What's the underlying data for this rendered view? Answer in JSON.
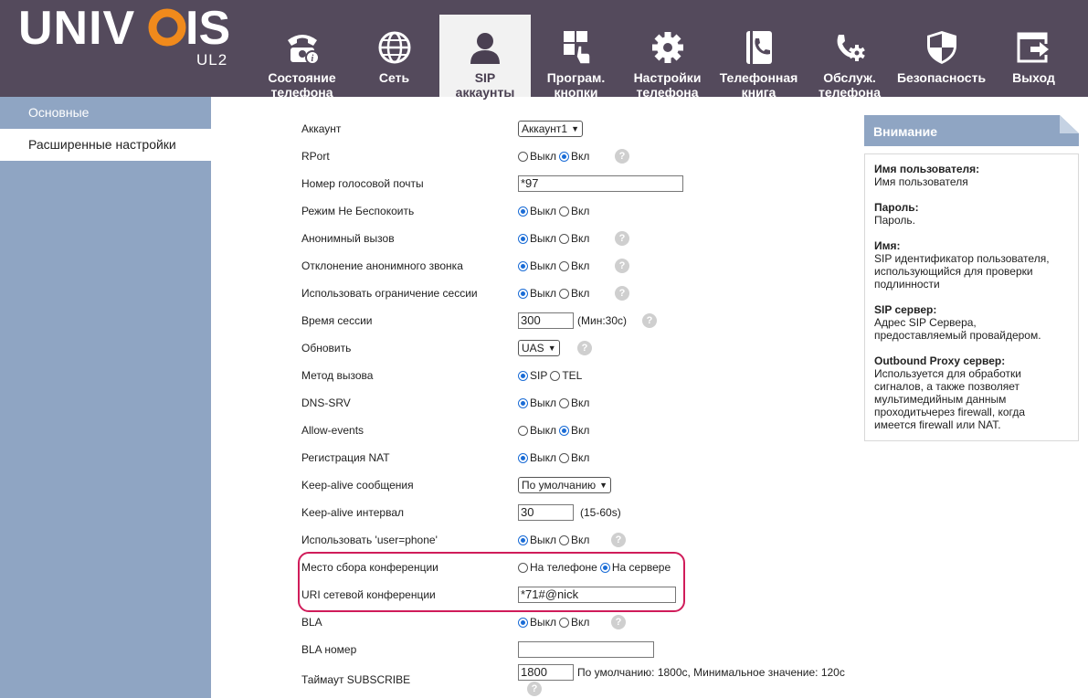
{
  "brand": {
    "logo": "UNIVOIS",
    "model": "UL2"
  },
  "nav": [
    {
      "label": "Состояние телефона",
      "icon": "phone-info-icon"
    },
    {
      "label": "Сеть",
      "icon": "globe-icon"
    },
    {
      "label": "SIP аккаунты",
      "icon": "user-icon",
      "active": true
    },
    {
      "label": "Програм. кнопки",
      "icon": "grid-touch-icon"
    },
    {
      "label": "Настройки телефона",
      "icon": "gear-icon"
    },
    {
      "label": "Телефонная книга",
      "icon": "phonebook-icon"
    },
    {
      "label": "Обслуж. телефона",
      "icon": "phone-wrench-icon"
    },
    {
      "label": "Безопасность",
      "icon": "shield-icon"
    },
    {
      "label": "Выход",
      "icon": "logout-icon"
    }
  ],
  "sidebar": {
    "items": [
      {
        "label": "Основные"
      },
      {
        "label": "Расширенные настройки",
        "active": true
      }
    ]
  },
  "radio_labels": {
    "off": "Выкл",
    "on": "Вкл",
    "sip": "SIP",
    "tel": "TEL",
    "phone": "На телефоне",
    "server": "На сервере"
  },
  "help_glyph": "?",
  "form": {
    "account": {
      "label": "Аккаунт",
      "value": "Аккаунт1"
    },
    "rport": {
      "label": "RPort",
      "value": "on"
    },
    "voicemail": {
      "label": "Номер голосовой почты",
      "value": "*97"
    },
    "dnd": {
      "label": "Режим Не Беспокоить",
      "value": "off"
    },
    "anon_call": {
      "label": "Анонимный вызов",
      "value": "off"
    },
    "anon_reject": {
      "label": "Отклонение анонимного звонка",
      "value": "off"
    },
    "session_limit": {
      "label": "Использовать ограничение сессии",
      "value": "off"
    },
    "session_time": {
      "label": "Время сессии",
      "value": "300",
      "unit": "(Мин:30с)"
    },
    "refresher": {
      "label": "Обновить",
      "value": "UAS"
    },
    "call_method": {
      "label": "Метод вызова",
      "value": "SIP"
    },
    "dns_srv": {
      "label": "DNS-SRV",
      "value": "off"
    },
    "allow_events": {
      "label": "Allow-events",
      "value": "on"
    },
    "nat_reg": {
      "label": "Регистрация NAT",
      "value": "off"
    },
    "keepalive_msg": {
      "label": "Keep-alive сообщения",
      "value": "По умолчанию"
    },
    "keepalive_int": {
      "label": "Keep-alive интервал",
      "value": "30",
      "unit": "(15-60s)"
    },
    "user_phone": {
      "label": "Использовать 'user=phone'",
      "value": "off"
    },
    "conf_place": {
      "label": "Место сбора конференции",
      "value": "server"
    },
    "conf_uri": {
      "label": "URI сетевой конференции",
      "value": "*71#@nick"
    },
    "bla": {
      "label": "BLA",
      "value": "off"
    },
    "bla_number": {
      "label": "BLA номер",
      "value": ""
    },
    "subscribe_timeout": {
      "label": "Таймаут SUBSCRIBE",
      "value": "1800",
      "unit": "По умолчанию: 1800с, Минимальное значение: 120с"
    }
  },
  "info": {
    "title": "Внимание",
    "sections": [
      {
        "title": "Имя пользователя:",
        "text": "Имя пользователя"
      },
      {
        "title": "Пароль:",
        "text": "Пароль."
      },
      {
        "title": "Имя:",
        "text": "SIP идентификатор пользователя, использующийся для проверки подлинности"
      },
      {
        "title": "SIP сервер:",
        "text": "Адрес SIP Сервера, предоставляемый провайдером."
      },
      {
        "title": "Outbound Proxy сервер:",
        "text": "Используется для обработки сигналов, а также позволяет мультимедийным данным проходитьчерез firewall, когда имеется firewall или NAT."
      }
    ]
  }
}
